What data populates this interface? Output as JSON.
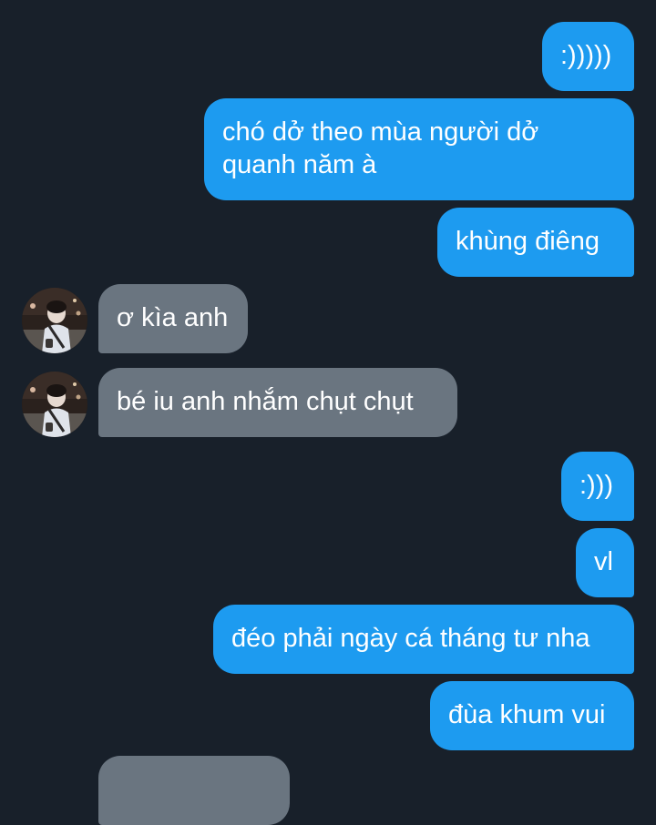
{
  "messages": [
    {
      "id": 1,
      "side": "out",
      "text": ":)))))"
    },
    {
      "id": 2,
      "side": "out",
      "text": "chó dở theo mùa người dở quanh năm à"
    },
    {
      "id": 3,
      "side": "out",
      "text": "khùng điêng"
    },
    {
      "id": 4,
      "side": "in",
      "text": "ơ kìa anh"
    },
    {
      "id": 5,
      "side": "in",
      "text": "bé iu anh nhắm chụt chụt"
    },
    {
      "id": 6,
      "side": "out",
      "text": ":)))"
    },
    {
      "id": 7,
      "side": "out",
      "text": "vl"
    },
    {
      "id": 8,
      "side": "out",
      "text": "đéo phải ngày cá tháng tư nha"
    },
    {
      "id": 9,
      "side": "out",
      "text": "đùa khum vui"
    }
  ],
  "colors": {
    "background": "#18202a",
    "outgoing_bubble": "#1d9bf0",
    "incoming_bubble": "#6a7580",
    "text": "#ffffff"
  }
}
